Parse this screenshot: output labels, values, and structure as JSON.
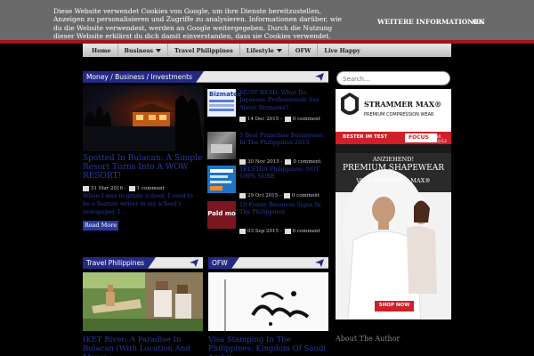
{
  "cookie": {
    "text": "Diese Website verwendet Cookies von Google, um ihre Dienste bereitzustellen, Anzeigen zu personalisieren und Zugriffe zu analysieren. Informationen darüber, wie du die Website verwendest, werden an Google weitergegeben. Durch die Nutzung dieser Website erklärst du dich damit einverstanden, dass sie Cookies verwendet.",
    "more_label": "WEITERE INFORMATIONEN",
    "ok_label": "OK"
  },
  "nav": {
    "items": [
      {
        "label": "Home",
        "dropdown": false
      },
      {
        "label": "Business",
        "dropdown": true
      },
      {
        "label": "Travel Philippines",
        "dropdown": false
      },
      {
        "label": "Lifestyle",
        "dropdown": true
      },
      {
        "label": "OFW",
        "dropdown": false
      },
      {
        "label": "Live Happy",
        "dropdown": false
      }
    ]
  },
  "sections": {
    "money": "Money / Business / Investments",
    "travel": "Travel Philippines",
    "ofw": "OFW"
  },
  "featured": {
    "title": "Spotted In Bulacan: A Simple Resort Turns Into A WOW RESORT!",
    "date": "31 Mar 2016 -",
    "comments": "1 comment",
    "excerpt": "When I was in grade school, I used to be a feature writer in my school's newspaper. I ...",
    "read_more": "Read More"
  },
  "posts": [
    {
      "title": "MUST READ: What Do Japanese Professionals Say About Bizmates?",
      "date": "14 Dec 2015 -",
      "comments": "0 comment",
      "thumb_text": "Bizmates"
    },
    {
      "title": "5 Best Franchise Businesses In The Philippines 2015",
      "date": "30 Nov 2015 -",
      "comments": "0 comment",
      "thumb_text": ""
    },
    {
      "title": "TELSTRA Philippines: NOT 100% SURE",
      "date": "29 Oct 2015 -",
      "comments": "0 comment",
      "thumb_text": ""
    },
    {
      "title": "19 Funny Business Signs In The Philippines",
      "date": "03 Sep 2015 -",
      "comments": "0 comment",
      "thumb_text": "Pald mo"
    }
  ],
  "bottom": {
    "travel_title": "IKET River: A Paradise In Bulacan (With Location And Maps)",
    "ofw_title": "Visa Stamping In The Philippines: Kingdom Of Saudi Arabia"
  },
  "sidebar": {
    "search_placeholder": "Search...",
    "about_title": "About The Author",
    "ad": {
      "brand": "STRAMMER MAX®",
      "brand_sub": "PREMIUM COMPRESSION WEAR",
      "test_label": "BESTER IM TEST",
      "focus": "FOCUS",
      "focus_issue": "NR. 42/12",
      "line1": "ANZIEHEND!",
      "line2": "PREMIUM SHAPEWEAR",
      "line3": "VON STRAMMER MAX®",
      "cta": "SHOP NOW"
    }
  },
  "colors": {
    "accent": "#232a86",
    "link": "#2a3a9f",
    "redbar": "#a31515",
    "ad_red": "#d0202a"
  }
}
